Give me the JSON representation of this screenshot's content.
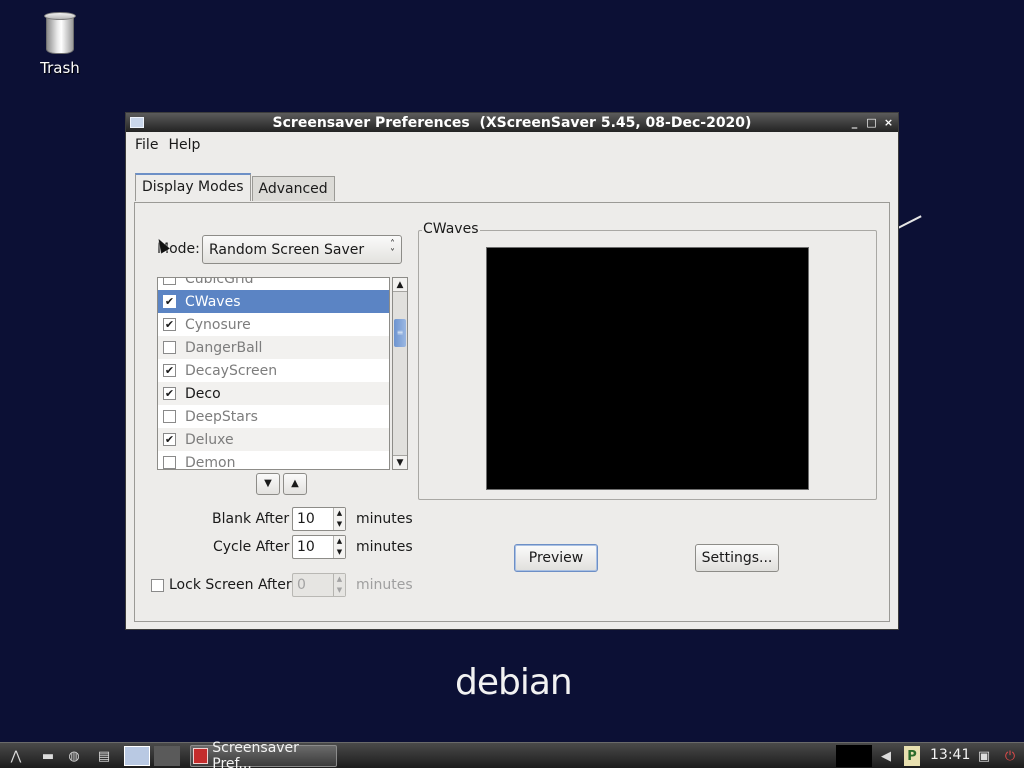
{
  "desktop": {
    "trash_label": "Trash",
    "brand": "debian"
  },
  "window": {
    "title": "Screensaver Preferences  (XScreenSaver 5.45, 08-Dec-2020)",
    "controls": {
      "minimize": "_",
      "maximize": "□",
      "close": "×"
    }
  },
  "menu": {
    "file": "File",
    "help": "Help"
  },
  "tabs": {
    "display_modes": "Display Modes",
    "advanced": "Advanced"
  },
  "mode": {
    "label": "Mode:",
    "value": "Random Screen Saver"
  },
  "savers": [
    {
      "name": "CubicGrid",
      "checked": false,
      "enabled": false
    },
    {
      "name": "CWaves",
      "checked": true,
      "enabled": true,
      "selected": true
    },
    {
      "name": "Cynosure",
      "checked": true,
      "enabled": false
    },
    {
      "name": "DangerBall",
      "checked": false,
      "enabled": false
    },
    {
      "name": "DecayScreen",
      "checked": true,
      "enabled": false
    },
    {
      "name": "Deco",
      "checked": true,
      "enabled": true
    },
    {
      "name": "DeepStars",
      "checked": false,
      "enabled": false
    },
    {
      "name": "Deluxe",
      "checked": true,
      "enabled": false
    },
    {
      "name": "Demon",
      "checked": false,
      "enabled": false
    }
  ],
  "timing": {
    "blank_after_label": "Blank After",
    "blank_after_value": "10",
    "cycle_after_label": "Cycle After",
    "cycle_after_value": "10",
    "lock_label": "Lock Screen After",
    "lock_value": "0",
    "lock_checked": false,
    "unit": "minutes"
  },
  "preview": {
    "frame_label": "CWaves",
    "preview_button": "Preview",
    "settings_button": "Settings..."
  },
  "taskbar": {
    "task_label": "Screensaver Pref...",
    "clock": "13:41"
  },
  "colors": {
    "desktop_bg": "#0c1035",
    "selection": "#5b84c4",
    "window_bg": "#edecea"
  }
}
